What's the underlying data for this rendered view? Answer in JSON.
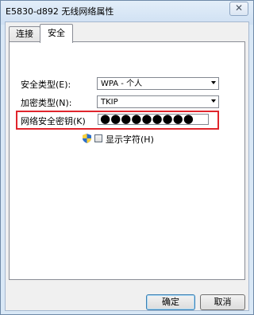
{
  "window": {
    "title": "E5830-d892 无线网络属性",
    "close_label": "✕"
  },
  "tabs": [
    {
      "label": "连接"
    },
    {
      "label": "安全"
    }
  ],
  "security": {
    "type_label": "安全类型(E):",
    "type_value": "WPA - 个人",
    "encryption_label": "加密类型(N):",
    "encryption_value": "TKIP",
    "key_label": "网络安全密钥(K)",
    "key_value": "●●●●●●●●●",
    "show_chars_label": "显示字符(H)"
  },
  "buttons": {
    "ok": "确定",
    "cancel": "取消"
  },
  "colors": {
    "highlight": "#e0252c",
    "ok_border": "#3c7fb1"
  }
}
